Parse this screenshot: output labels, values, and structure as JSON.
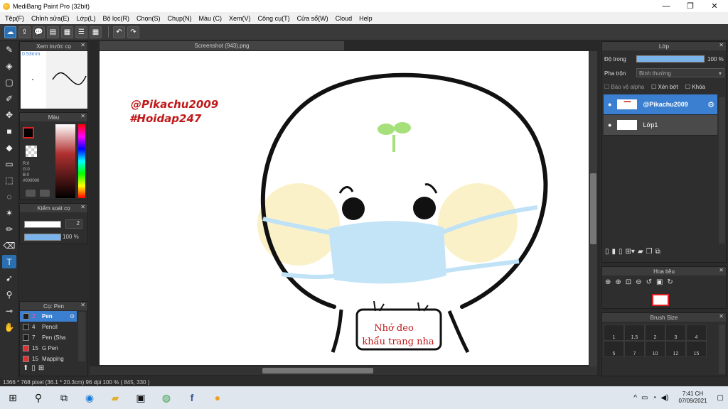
{
  "window": {
    "title": "MediBang Paint Pro (32bit)",
    "min": "—",
    "max": "❐",
    "close": "✕"
  },
  "menu": [
    "Tệp(F)",
    "Chỉnh sửa(E)",
    "Lớp(L)",
    "Bộ lọc(R)",
    "Chọn(S)",
    "Chụp(N)",
    "Màu (C)",
    "Xem(V)",
    "Công cụ(T)",
    "Cửa sổ(W)",
    "Cloud",
    "Help"
  ],
  "panels": {
    "preview": {
      "title": "Xem trước cọ",
      "size": "0.53mm"
    },
    "color": {
      "title": "Màu",
      "r": "R:0",
      "g": "G:0",
      "b": "B:0",
      "hex": "#000000"
    },
    "brushctl": {
      "title": "Kiểm soát cọ",
      "size": "2",
      "opacity": "100 %"
    },
    "brushes": {
      "title": "Cọ: Pen",
      "items": [
        {
          "num": "2",
          "name": "Pen",
          "color": "#1e1e1e"
        },
        {
          "num": "4",
          "name": "Pencil",
          "color": "#1e1e1e"
        },
        {
          "num": "7",
          "name": "Pen (Sha",
          "color": "#1e1e1e"
        },
        {
          "num": "15",
          "name": "G Pen",
          "color": "#e03030"
        },
        {
          "num": "15",
          "name": "Mapping",
          "color": "#e03030"
        }
      ]
    },
    "layers": {
      "title": "Lớp",
      "opacity_label": "Độ trong",
      "opacity_value": "100 %",
      "blend_label": "Pha trộn",
      "blend_value": "Bình thường",
      "protect_alpha": "Bảo vệ alpha",
      "clip": "Xén bớt",
      "lock": "Khóa",
      "items": [
        {
          "name": "@Pikachu2009",
          "selected": true
        },
        {
          "name": "Lớp1",
          "selected": false
        }
      ]
    },
    "navigator": {
      "title": "Hoa tiêu"
    },
    "brushsize": {
      "title": "Brush Size",
      "sizes": [
        "1",
        "1.5",
        "2",
        "3",
        "4",
        "5",
        "7",
        "10",
        "12",
        "15"
      ]
    }
  },
  "document": {
    "tab": "Screenshot (943).png"
  },
  "artwork": {
    "watermark1": "@Pikachu2009",
    "watermark2": "#Hoidap247",
    "sign_line1": "Nhớ đeo",
    "sign_line2": "khẩu trang nha"
  },
  "status": "1366 * 768 pixel   (36.1 * 20.3cm)   96 dpi   100 %   ( 845, 330 )",
  "taskbar": {
    "time": "7:41 CH",
    "date": "07/09/2021"
  },
  "colors": {
    "accent": "#3a7fd0",
    "watermark": "#c01818"
  }
}
